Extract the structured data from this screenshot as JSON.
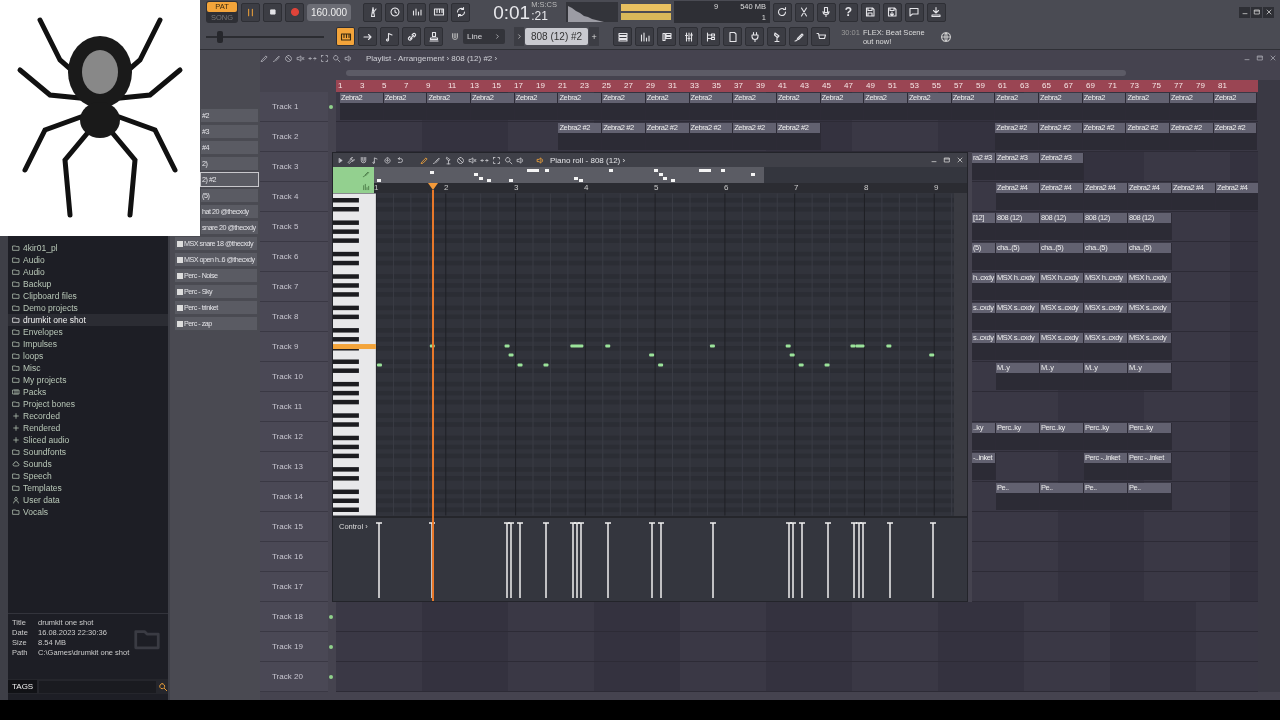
{
  "transport": {
    "modes": [
      {
        "label": "PAT",
        "selected": true
      },
      {
        "label": "SONG",
        "selected": false
      }
    ],
    "tempo": "160.000",
    "time_main": "0:01",
    "time_units": "M:S:CS",
    "time_sub": ":21",
    "cpu": "9",
    "memory": "540 MB",
    "polyphony": "1",
    "help": "?"
  },
  "toolbar": {
    "pitch": {
      "level": 0.12
    },
    "snap": "Line",
    "pattern": "808 (12) #2",
    "add_pattern": "+",
    "news_time": "30:01",
    "news_text": "FLEX: Beat Scene out now!"
  },
  "channels": [
    {
      "name": "#2",
      "selected": false
    },
    {
      "name": "#3",
      "selected": false
    },
    {
      "name": "#4",
      "selected": false
    },
    {
      "name": "2)",
      "selected": false
    },
    {
      "name": "2) #2",
      "selected": true
    },
    {
      "name": "(5)",
      "selected": false
    },
    {
      "name": "hat 20 @thecxdy",
      "selected": false
    },
    {
      "name": "snare 20 @thecxdy",
      "selected": false
    },
    {
      "name": "MSX snare 18 @thecxdy",
      "selected": false
    },
    {
      "name": "MSX open h..6 @thecxdy",
      "selected": false
    },
    {
      "name": "Perc - Noise",
      "selected": false
    },
    {
      "name": "Perc - Sky",
      "selected": false
    },
    {
      "name": "Perc - trinket",
      "selected": false
    },
    {
      "name": "Perc - zap",
      "selected": false
    }
  ],
  "browser": {
    "items": [
      {
        "label": "4kir01_pl",
        "kind": "folder",
        "selected": false
      },
      {
        "label": "Audio",
        "kind": "folder",
        "selected": false
      },
      {
        "label": "Audio",
        "kind": "folder",
        "selected": false
      },
      {
        "label": "Backup",
        "kind": "folder",
        "selected": false
      },
      {
        "label": "Clipboard files",
        "kind": "folder",
        "selected": false
      },
      {
        "label": "Demo projects",
        "kind": "folder",
        "selected": false
      },
      {
        "label": "drumkit one shot",
        "kind": "folder",
        "selected": true
      },
      {
        "label": "Envelopes",
        "kind": "folder",
        "selected": false
      },
      {
        "label": "Impulses",
        "kind": "folder",
        "selected": false
      },
      {
        "label": "loops",
        "kind": "folder",
        "selected": false
      },
      {
        "label": "Misc",
        "kind": "folder",
        "selected": false
      },
      {
        "label": "My projects",
        "kind": "folder",
        "selected": false
      },
      {
        "label": "Packs",
        "kind": "packs",
        "selected": false
      },
      {
        "label": "Project bones",
        "kind": "folder",
        "selected": false
      },
      {
        "label": "Recorded",
        "kind": "plus",
        "selected": false
      },
      {
        "label": "Rendered",
        "kind": "plus",
        "selected": false
      },
      {
        "label": "Sliced audio",
        "kind": "plus",
        "selected": false
      },
      {
        "label": "Soundfonts",
        "kind": "folder",
        "selected": false
      },
      {
        "label": "Sounds",
        "kind": "cloud",
        "selected": false
      },
      {
        "label": "Speech",
        "kind": "folder",
        "selected": false
      },
      {
        "label": "Templates",
        "kind": "folder",
        "selected": false
      },
      {
        "label": "User data",
        "kind": "user",
        "selected": false
      },
      {
        "label": "Vocals",
        "kind": "folder",
        "selected": false
      }
    ],
    "info": [
      {
        "label": "Title",
        "value": "drumkit one shot"
      },
      {
        "label": "Date",
        "value": "16.08.2023 22:30:36"
      },
      {
        "label": "Size",
        "value": "8.54 MB"
      },
      {
        "label": "Path",
        "value": "C:\\Games\\drumkit one shot"
      }
    ],
    "tags_label": "TAGS"
  },
  "playlist": {
    "title": "Playlist - Arrangement › 808 (12) #2 ›",
    "ruler": [
      "1",
      "3",
      "5",
      "7",
      "9",
      "11",
      "13",
      "15",
      "17",
      "19",
      "21",
      "23",
      "25",
      "27",
      "29",
      "31",
      "33",
      "35",
      "37",
      "39",
      "41",
      "43",
      "45",
      "47",
      "49",
      "51",
      "53",
      "55",
      "57",
      "59",
      "61",
      "63",
      "65",
      "67",
      "69",
      "71",
      "73",
      "75",
      "77",
      "79",
      "81"
    ],
    "tracks": [
      {
        "name": "Track 1",
        "clips": [
          "Zebra2",
          "Zebra2",
          "Zebra2",
          "Zebra2",
          "Zebra2",
          "Zebra2",
          "Zebra2",
          "Zebra2",
          "Zebra2",
          "Zebra2",
          "Zebra2",
          "Zebra2",
          "Zebra2",
          "Zebra2",
          "Zebra2",
          "Zebra2",
          "Zebra2",
          "Zebra2",
          "Zebra2",
          "Zebra2",
          "Zebra2"
        ]
      },
      {
        "name": "Track 2",
        "clips": [
          "Zebra2 #2",
          "Zebra2 #2",
          "Zebra2 #2",
          "Zebra2 #2",
          "Zebra2 #2",
          "Zebra2 #2",
          "Zebra2 #2",
          "Zebra2 #2",
          "Zebra2 #2",
          "Zebra2 #2",
          "Zebra2 #2",
          "Zebra2 #2"
        ]
      },
      {
        "name": "Track 3",
        "clips": [
          "ra2 #3",
          "Zebra2 #3",
          "Zebra2 #3"
        ]
      },
      {
        "name": "Track 4",
        "clips": [
          "Zebra2 #4",
          "Zebra2 #4",
          "Zebra2 #4",
          "Zebra2 #4",
          "Zebra2 #4",
          "Zebra2 #4"
        ]
      },
      {
        "name": "Track 5",
        "clips": [
          "[12]",
          "808 (12)",
          "808 (12)",
          "808 (12)",
          "808 (12)"
        ]
      },
      {
        "name": "Track 6",
        "clips": [
          "(5)",
          "cha..(5)",
          "cha..(5)",
          "cha..(5)",
          "cha..(5)"
        ]
      },
      {
        "name": "Track 7",
        "clips": [
          "h..cxdy",
          "MSX h..cxdy",
          "MSX h..cxdy",
          "MSX h..cxdy",
          "MSX h..cxdy"
        ]
      },
      {
        "name": "Track 8",
        "clips": [
          "s..cxdy",
          "MSX s..cxdy",
          "MSX s..cxdy",
          "MSX s..cxdy",
          "MSX s..cxdy"
        ]
      },
      {
        "name": "Track 9",
        "clips": [
          "s..cxdy",
          "MSX s..cxdy",
          "MSX s..cxdy",
          "MSX s..cxdy",
          "MSX s..cxdy"
        ]
      },
      {
        "name": "Track 10",
        "clips": [
          "M..y",
          "M..y",
          "M..y",
          "M..y"
        ]
      },
      {
        "name": "Track 11"
      },
      {
        "name": "Track 12",
        "clips": [
          "..ky",
          "Perc..ky",
          "Perc..ky",
          "Perc..ky",
          "Perc..ky"
        ]
      },
      {
        "name": "Track 13",
        "clips": [
          "-..inket",
          "Perc -..inket",
          "Perc -..inket"
        ]
      },
      {
        "name": "Track 14",
        "clips": [
          "Pe..",
          "Pe..",
          "Pe..",
          "Pe.."
        ]
      },
      {
        "name": "Track 15"
      },
      {
        "name": "Track 16"
      },
      {
        "name": "Track 17"
      },
      {
        "name": "Track 18"
      },
      {
        "name": "Track 19"
      },
      {
        "name": "Track 20"
      }
    ]
  },
  "piano_roll": {
    "title": "Piano roll - 808 (12) ›",
    "ruler": [
      "1",
      "2",
      "3",
      "4",
      "5",
      "6",
      "7",
      "8",
      "9"
    ],
    "control_label": "Control ›"
  }
}
